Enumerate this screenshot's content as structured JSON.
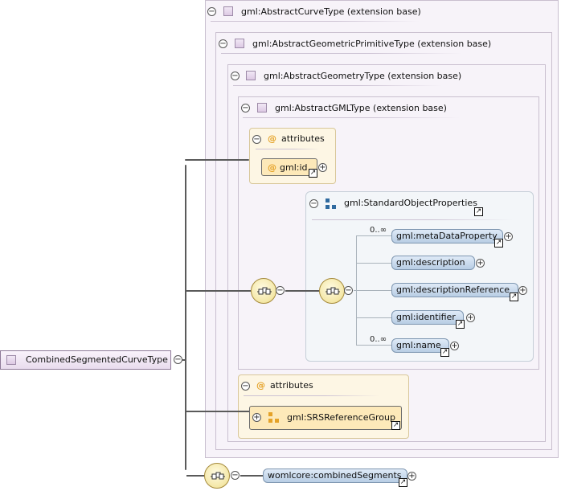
{
  "root": {
    "label": "CombinedSegmentedCurveType"
  },
  "frames": [
    {
      "label": "gml:AbstractCurveType (extension base)"
    },
    {
      "label": "gml:AbstractGeometricPrimitiveType (extension base)"
    },
    {
      "label": "gml:AbstractGeometryType (extension base)"
    },
    {
      "label": "gml:AbstractGMLType (extension base)"
    }
  ],
  "attributes_top": {
    "label": "attributes",
    "item": "gml:id"
  },
  "group": {
    "label": "gml:StandardObjectProperties",
    "elements": [
      {
        "label": "gml:metaDataProperty",
        "cardinality": "0..∞"
      },
      {
        "label": "gml:description",
        "cardinality": ""
      },
      {
        "label": "gml:descriptionReference",
        "cardinality": ""
      },
      {
        "label": "gml:identifier",
        "cardinality": ""
      },
      {
        "label": "gml:name",
        "cardinality": "0..∞"
      }
    ]
  },
  "attributes_bottom": {
    "label": "attributes",
    "item": "gml:SRSReferenceGroup"
  },
  "final_element": {
    "label": "womlcore:combinedSegments"
  },
  "glyphs": {
    "collapse": "−",
    "expand": "+",
    "link": "↗",
    "at": "@"
  },
  "colors": {
    "frame_bg": "#f7f3f9",
    "attr_bg": "#fdf6e4",
    "element_fill": "#b8cde4",
    "accent_orange": "#e5a227",
    "group_icon_blue": "#2f6a9f"
  }
}
